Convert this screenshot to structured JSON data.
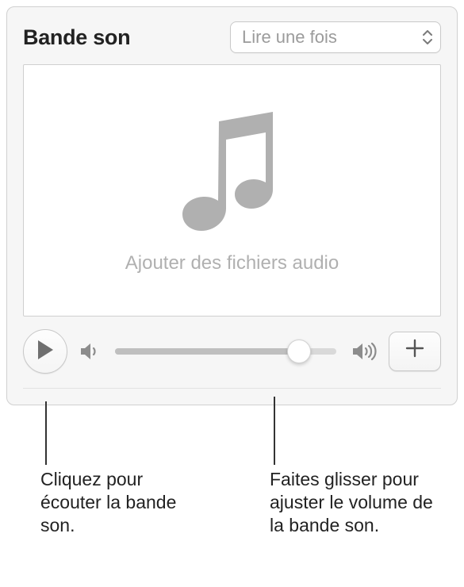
{
  "header": {
    "title": "Bande son"
  },
  "popup": {
    "selected": "Lire une fois"
  },
  "dropzone": {
    "placeholder": "Ajouter des fichiers audio"
  },
  "callouts": {
    "play": "Cliquez pour écouter la bande son.",
    "volume": "Faites glisser pour ajuster le volume de la bande son."
  },
  "slider": {
    "value_percent": 83
  },
  "icons": {
    "play": "play",
    "volume_low": "volume-low",
    "volume_high": "volume-high",
    "add": "add",
    "music_note": "music-note",
    "dropdown_arrows": "up-down-arrows"
  }
}
